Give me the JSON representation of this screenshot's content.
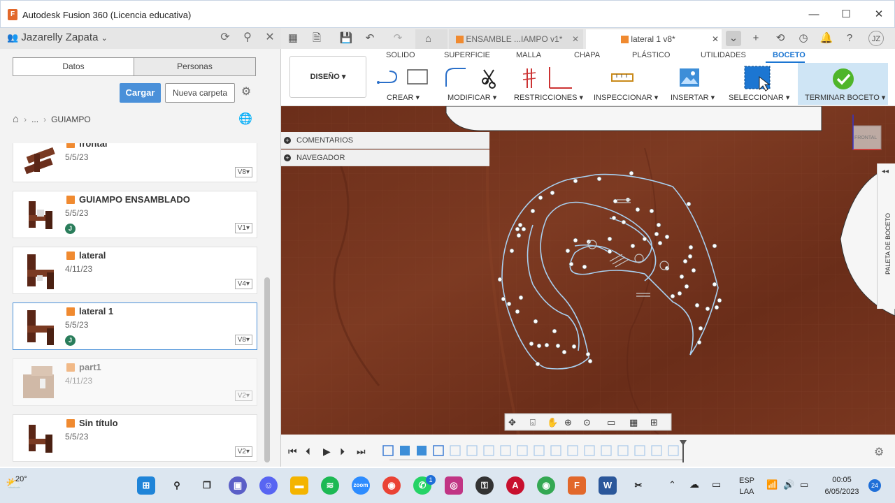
{
  "window": {
    "title": "Autodesk Fusion 360 (Licencia educativa)",
    "app_icon_letter": "F"
  },
  "data_panel": {
    "user_name": "Jazarelly Zapata",
    "tabs": [
      "Datos",
      "Personas"
    ],
    "upload_label": "Cargar",
    "new_folder_label": "Nueva carpeta",
    "breadcrumb_ellipsis": "...",
    "breadcrumb_current": "GUIAMPO",
    "files": [
      {
        "name": "frontal",
        "date": "5/5/23",
        "version": "V8▾",
        "avatar": ""
      },
      {
        "name": "GUIAMPO ENSAMBLADO",
        "date": "5/5/23",
        "version": "V1▾",
        "avatar": "J"
      },
      {
        "name": "lateral",
        "date": "4/11/23",
        "version": "V4▾",
        "avatar": ""
      },
      {
        "name": "lateral 1",
        "date": "5/5/23",
        "version": "V8▾",
        "avatar": "J"
      },
      {
        "name": "part1",
        "date": "4/11/23",
        "version": "V2▾",
        "avatar": ""
      },
      {
        "name": "Sin título",
        "date": "5/5/23",
        "version": "V2▾",
        "avatar": ""
      }
    ]
  },
  "doc_tabs": [
    {
      "label": "ENSAMBLE ...IAMPO v1*"
    },
    {
      "label": "lateral 1 v8*"
    }
  ],
  "ribbon": {
    "tabs": [
      "SOLIDO",
      "SUPERFICIE",
      "MALLA",
      "CHAPA",
      "PLÁSTICO",
      "UTILIDADES",
      "BOCETO"
    ],
    "design_label": "DISEÑO ▾",
    "groups": [
      "CREAR ▾",
      "MODIFICAR ▾",
      "RESTRICCIONES ▾",
      "INSPECCIONAR ▾",
      "INSERTAR ▾",
      "SELECCIONAR ▾",
      "TERMINAR BOCETO ▾"
    ]
  },
  "browser_panels": {
    "comments": "COMENTARIOS",
    "navigator": "NAVEGADOR"
  },
  "sketch_palette_label": "PALETA DE BOCETO",
  "viewcube_label": "FRONTAL",
  "user_initials": "JZ",
  "taskbar": {
    "temperature": "20°",
    "language": "ESP",
    "language_sub": "LAA",
    "time": "00:05",
    "date": "6/05/2023",
    "notification_count": "24",
    "whatsapp_badge": "1"
  }
}
